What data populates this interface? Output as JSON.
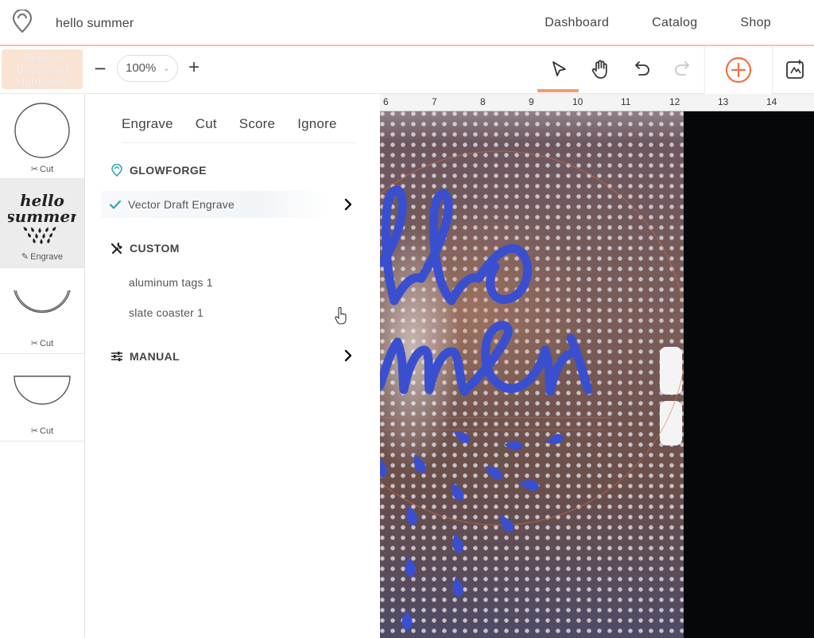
{
  "header": {
    "doc_title": "hello summer",
    "nav": [
      "Dashboard",
      "Catalog",
      "Shop"
    ]
  },
  "toolbar": {
    "material_label": "Medium Basswood Hardwood",
    "zoom_minus": "−",
    "zoom_value": "100%",
    "zoom_plus": "+",
    "tools": [
      "select-arrow-icon",
      "hand-icon",
      "undo-icon",
      "redo-icon"
    ],
    "add_icon": "plus-circle-icon",
    "magic_icon": "magic-canvas-icon"
  },
  "thumbnails": [
    {
      "label": "Cut",
      "icon": "scissors-icon",
      "shape": "circle"
    },
    {
      "label": "Engrave",
      "icon": "pencil-icon",
      "shape": "hello-summer-art",
      "art_text": [
        "hello",
        "summer"
      ]
    },
    {
      "label": "Cut",
      "icon": "scissors-icon",
      "shape": "arc"
    },
    {
      "label": "Cut",
      "icon": "scissors-icon",
      "shape": "half-circle"
    }
  ],
  "panel": {
    "tabs": [
      "Engrave",
      "Cut",
      "Score",
      "Ignore"
    ],
    "sections": {
      "glowforge": {
        "title": "GLOWFORGE",
        "selected_item": "Vector Draft Engrave"
      },
      "custom": {
        "title": "CUSTOM",
        "items": [
          "aluminum tags 1",
          "slate coaster 1"
        ]
      },
      "manual": {
        "title": "MANUAL"
      }
    }
  },
  "bed": {
    "ruler": [
      "6",
      "7",
      "8",
      "9",
      "10",
      "11",
      "12",
      "13",
      "14"
    ]
  },
  "colors": {
    "accent": "#f2703e",
    "check": "#36a3b8",
    "design_blue": "#3a4fd0",
    "bed_black": "#04080b"
  }
}
